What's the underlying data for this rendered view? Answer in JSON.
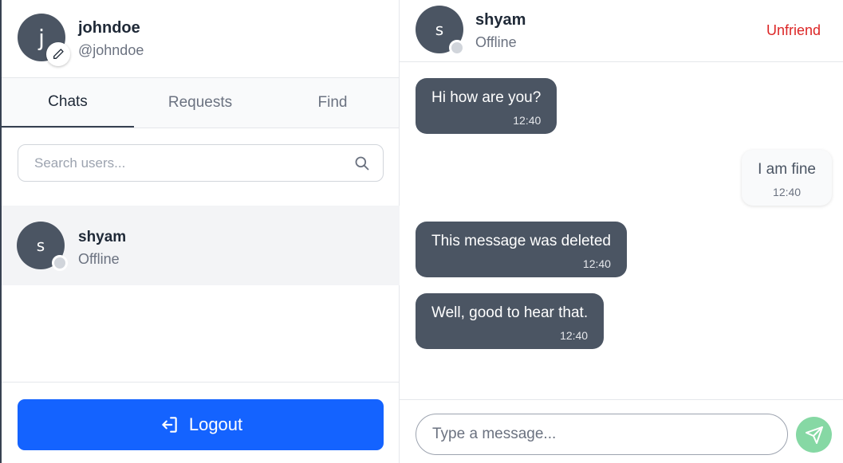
{
  "profile": {
    "avatar_letter": "j",
    "name": "johndoe",
    "handle": "@johndoe"
  },
  "tabs": [
    {
      "label": "Chats",
      "active": true
    },
    {
      "label": "Requests",
      "active": false
    },
    {
      "label": "Find",
      "active": false
    }
  ],
  "search": {
    "placeholder": "Search users...",
    "value": ""
  },
  "contacts": [
    {
      "avatar_letter": "s",
      "name": "shyam",
      "status": "Offline"
    }
  ],
  "logout_label": "Logout",
  "chat": {
    "avatar_letter": "s",
    "name": "shyam",
    "status": "Offline",
    "unfriend_label": "Unfriend",
    "messages": [
      {
        "text": "Hi how are you?",
        "time": "12:40",
        "direction": "incoming"
      },
      {
        "text": "I am fine",
        "time": "12:40",
        "direction": "outgoing"
      },
      {
        "text": "This message was deleted",
        "time": "12:40",
        "direction": "incoming"
      },
      {
        "text": "Well, good to hear that.",
        "time": "12:40",
        "direction": "incoming"
      }
    ],
    "input_placeholder": "Type a message...",
    "input_value": ""
  },
  "colors": {
    "accent": "#1463ff",
    "avatar_bg": "#4b5563",
    "danger": "#dc2626",
    "send_button": "#86d8a4",
    "offline_dot": "#d1d5db"
  }
}
